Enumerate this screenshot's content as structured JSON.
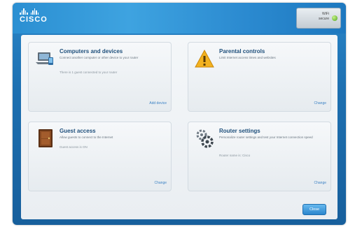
{
  "brand": {
    "name": "CISCO"
  },
  "status": {
    "line1": "WiFi",
    "line2": "secure"
  },
  "cards": [
    {
      "title": "Computers and devices",
      "desc": "Connect another computer or other device to your router",
      "status": "There is 1 guest connected to your router",
      "link": "Add device",
      "icon": "laptop-icon"
    },
    {
      "title": "Parental controls",
      "desc": "Limit Internet access times and websites",
      "status": "",
      "link": "Change",
      "icon": "warning-icon"
    },
    {
      "title": "Guest access",
      "desc": "Allow guests to connect to the Internet",
      "status": "Guest access is ON",
      "link": "Change",
      "icon": "door-icon"
    },
    {
      "title": "Router settings",
      "desc": "Personalize router settings and test your Internet connection speed",
      "status": "Router name is: Cisco",
      "link": "Change",
      "icon": "gears-icon"
    }
  ],
  "footer": {
    "close_label": "Close"
  }
}
